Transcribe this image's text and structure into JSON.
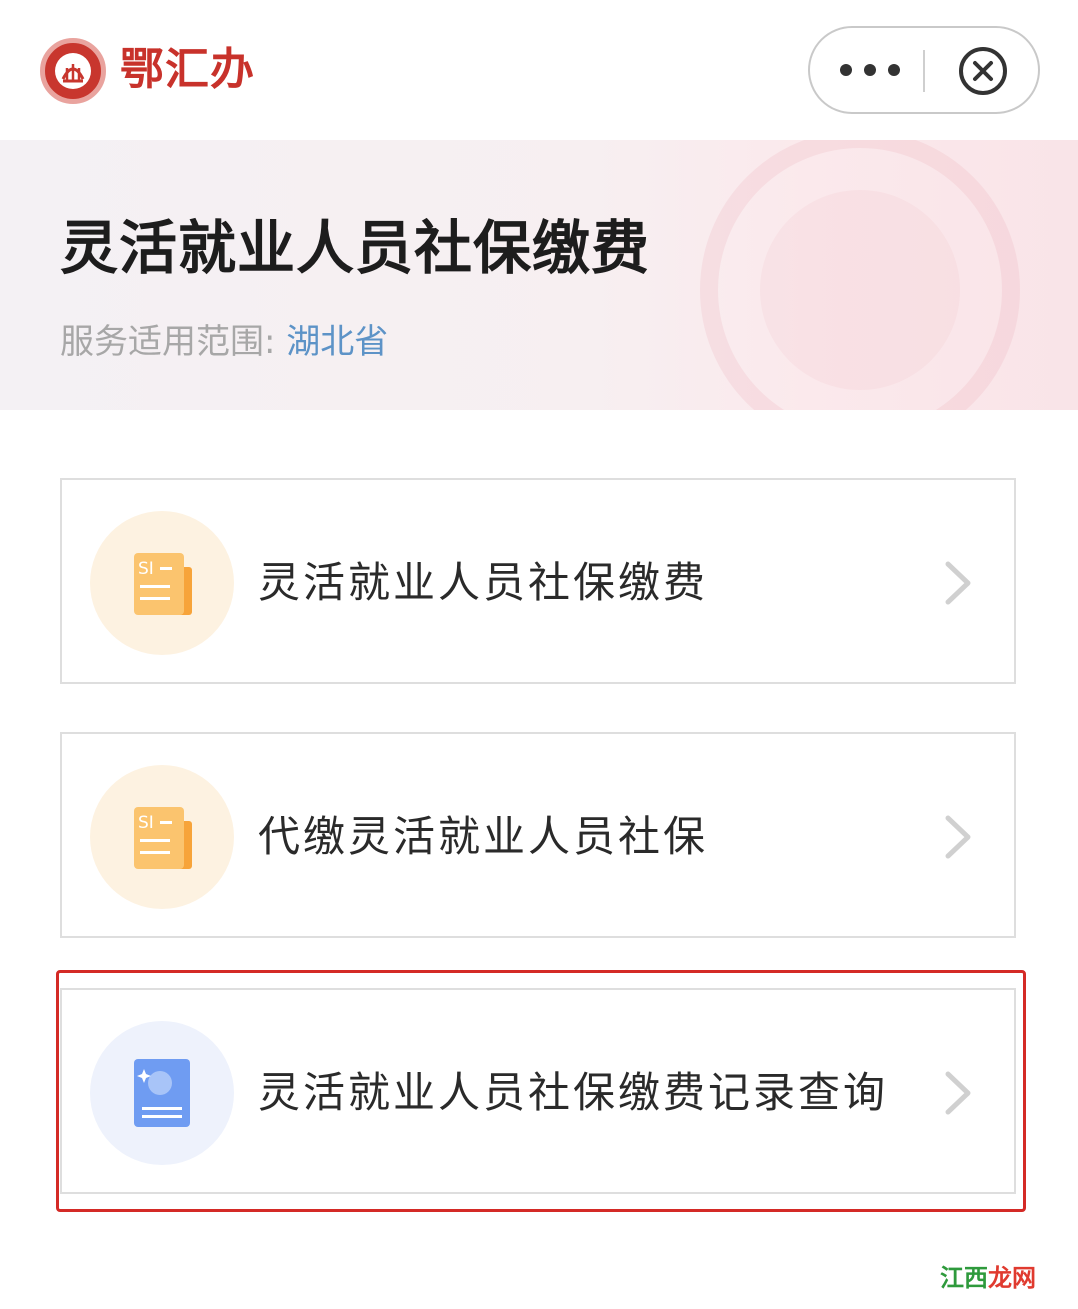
{
  "header": {
    "app_name": "鄂汇办"
  },
  "banner": {
    "title": "灵活就业人员社保缴费",
    "scope_label": "服务适用范围:",
    "scope_value": "湖北省"
  },
  "services": [
    {
      "label": "灵活就业人员社保缴费",
      "icon": "si-document-icon",
      "icon_text": "SI"
    },
    {
      "label": "代缴灵活就业人员社保",
      "icon": "si-document-icon",
      "icon_text": "SI"
    },
    {
      "label": "灵活就业人员社保缴费记录查询",
      "icon": "record-query-icon",
      "highlighted": true
    }
  ],
  "watermark": {
    "part1": "江西",
    "part2": "龙网"
  },
  "colors": {
    "brand_red": "#c8322b",
    "scope_blue": "#5d93c7",
    "icon_orange": "#f9b352",
    "icon_blue": "#6f9cf2",
    "highlight_red": "#d42a26"
  }
}
